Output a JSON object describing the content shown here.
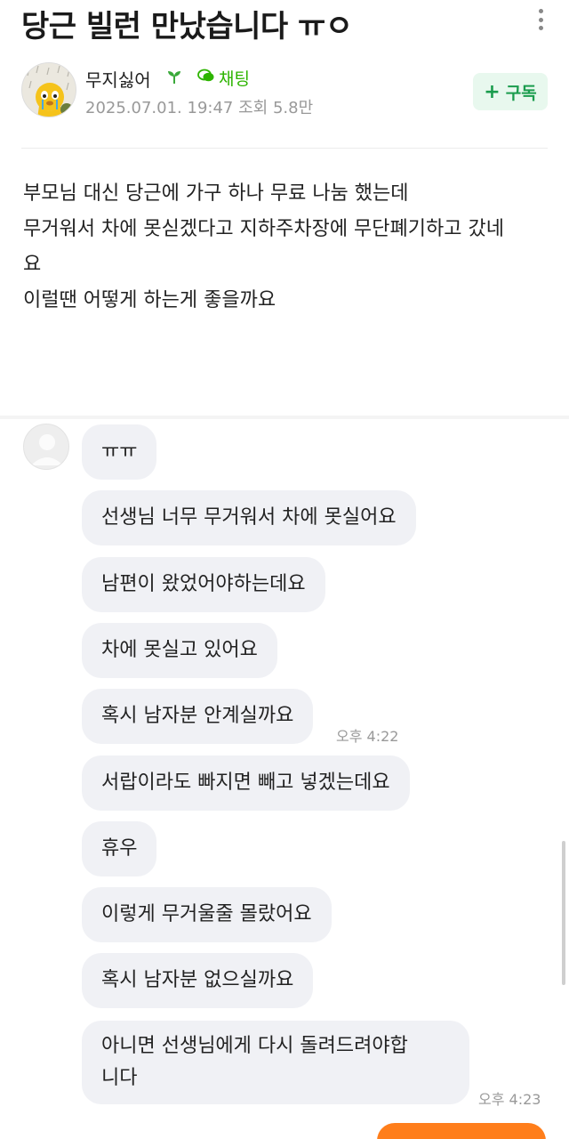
{
  "post": {
    "title": "당근 빌런 만났습니다 ㅠㅇ",
    "body": [
      "부모님 대신 당근에 가구 하나 무료 나눔 했는데",
      "무거워서 차에 못싣겠다고 지하주차장에 무단폐기하고 갔네",
      "요",
      "이럴땐 어떻게 하는게 좋을까요"
    ]
  },
  "author": {
    "name": "무지싫어",
    "chat_label": "채팅",
    "date": "2025.07.01. 19:47",
    "views": "조회 5.8만"
  },
  "subscribe": {
    "label": "구독"
  },
  "icons": {
    "more": "more-vertical-icon",
    "sprout": "sprout-icon",
    "chat": "chat-bubble-icon",
    "plus": "plus-icon"
  },
  "colors": {
    "accent_green": "#2db400",
    "bubble_bg": "#f0f1f5",
    "orange": "#ff7e1b"
  },
  "chat": {
    "messages": [
      {
        "text": "ㅠㅠ"
      },
      {
        "text": "선생님 너무 무거워서 차에 못실어요"
      },
      {
        "text": "남편이 왔었어야하는데요"
      },
      {
        "text": "차에 못실고 있어요"
      },
      {
        "text": "혹시 남자분 안계실까요",
        "time": "오후 4:22"
      },
      {
        "text": "서랍이라도 빠지면 빼고 넣겠는데요"
      },
      {
        "text": "휴우"
      },
      {
        "text": "이렇게 무거울줄 몰랐어요"
      },
      {
        "text": "혹시 남자분 없으실까요"
      },
      {
        "text": "아니면 선생님에게 다시 돌려드려야합니다",
        "line1": "아니면 선생님에게 다시 돌려드려야합",
        "line2": "니다",
        "time": "오후 4:23"
      }
    ]
  }
}
